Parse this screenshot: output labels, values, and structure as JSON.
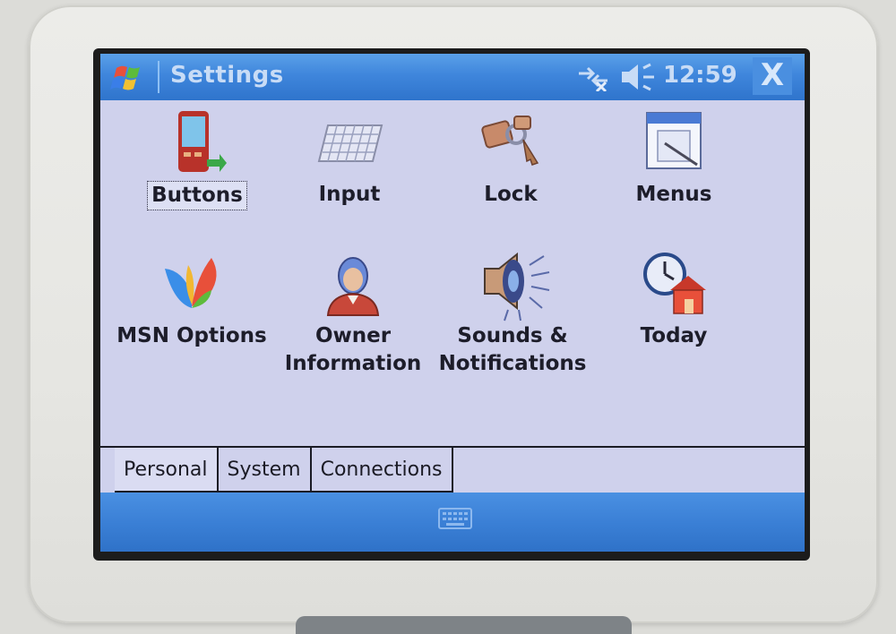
{
  "titlebar": {
    "title": "Settings",
    "time": "12:59",
    "close_label": "X"
  },
  "icons": [
    {
      "label": "Buttons",
      "icon": "device-buttons-icon",
      "selected": true
    },
    {
      "label": "Input",
      "icon": "keyboard-icon"
    },
    {
      "label": "Lock",
      "icon": "keys-icon"
    },
    {
      "label": "Menus",
      "icon": "menus-window-icon"
    },
    {
      "label": "MSN Options",
      "icon": "msn-butterfly-icon"
    },
    {
      "label": "Owner\nInformation",
      "line1": "Owner",
      "line2": "Information",
      "icon": "owner-person-icon"
    },
    {
      "label": "Sounds &\nNotifications",
      "line1": "Sounds &",
      "line2": "Notifications",
      "icon": "speaker-icon"
    },
    {
      "label": "Today",
      "icon": "clock-home-icon"
    }
  ],
  "tabs": [
    {
      "label": "Personal",
      "active": true
    },
    {
      "label": "System"
    },
    {
      "label": "Connections"
    }
  ],
  "colors": {
    "titlebar": "#3f86dc",
    "screen_background": "#cfd1ec",
    "softbar": "#3b80d6"
  }
}
